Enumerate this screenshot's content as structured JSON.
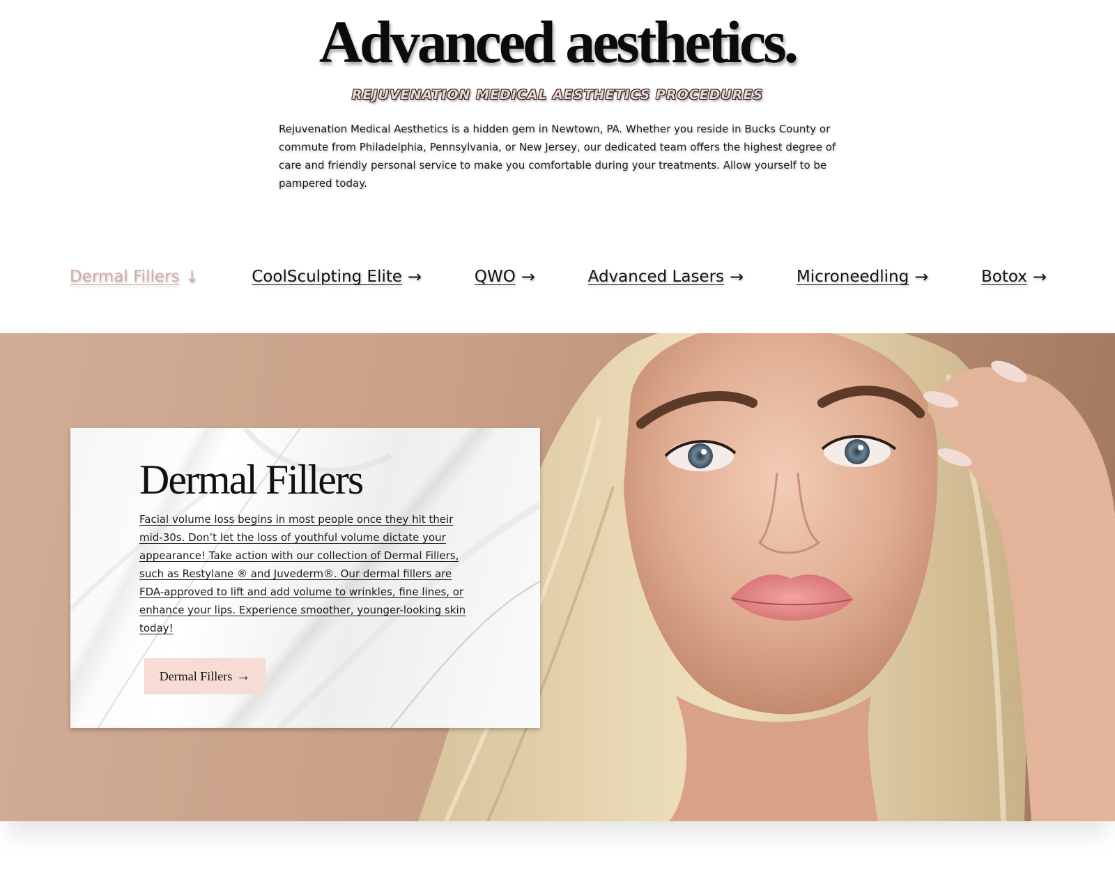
{
  "hero": {
    "title": "Advanced aesthetics.",
    "subtitle": "REJUVENATION MEDICAL AESTHETICS PROCEDURES",
    "intro": "Rejuvenation Medical Aesthetics is a hidden gem in Newtown, PA. Whether you reside in Bucks County or commute from Philadelphia, Pennsylvania, or New Jersey, our dedicated team offers the highest degree of care and friendly personal service to make you comfortable during your treatments. Allow yourself to be pampered today."
  },
  "procedures": [
    {
      "label": "Dermal Fillers",
      "arrow": "↓",
      "active": true
    },
    {
      "label": "CoolSculpting Elite",
      "arrow": "→",
      "active": false
    },
    {
      "label": "QWO",
      "arrow": "→",
      "active": false
    },
    {
      "label": "Advanced Lasers",
      "arrow": "→",
      "active": false
    },
    {
      "label": "Microneedling",
      "arrow": "→",
      "active": false
    },
    {
      "label": "Botox",
      "arrow": "→",
      "active": false
    }
  ],
  "feature": {
    "title": "Dermal Fillers",
    "text": "Facial volume loss begins in most people once they hit their mid-30s. Don’t let the loss of youthful volume dictate your appearance! Take action with our collection of Dermal Fillers, such as Restylane ® and Juvederm®. Our dermal fillers are FDA-approved to lift and add volume to wrinkles, fine lines, or enhance your lips. Experience smoother, younger-looking skin today!",
    "button_label": "Dermal Fillers",
    "button_arrow": "→"
  },
  "colors": {
    "accent_pink": "#f7dcd5",
    "active_link": "#d3a9a2",
    "band_background": "#c9a087"
  }
}
